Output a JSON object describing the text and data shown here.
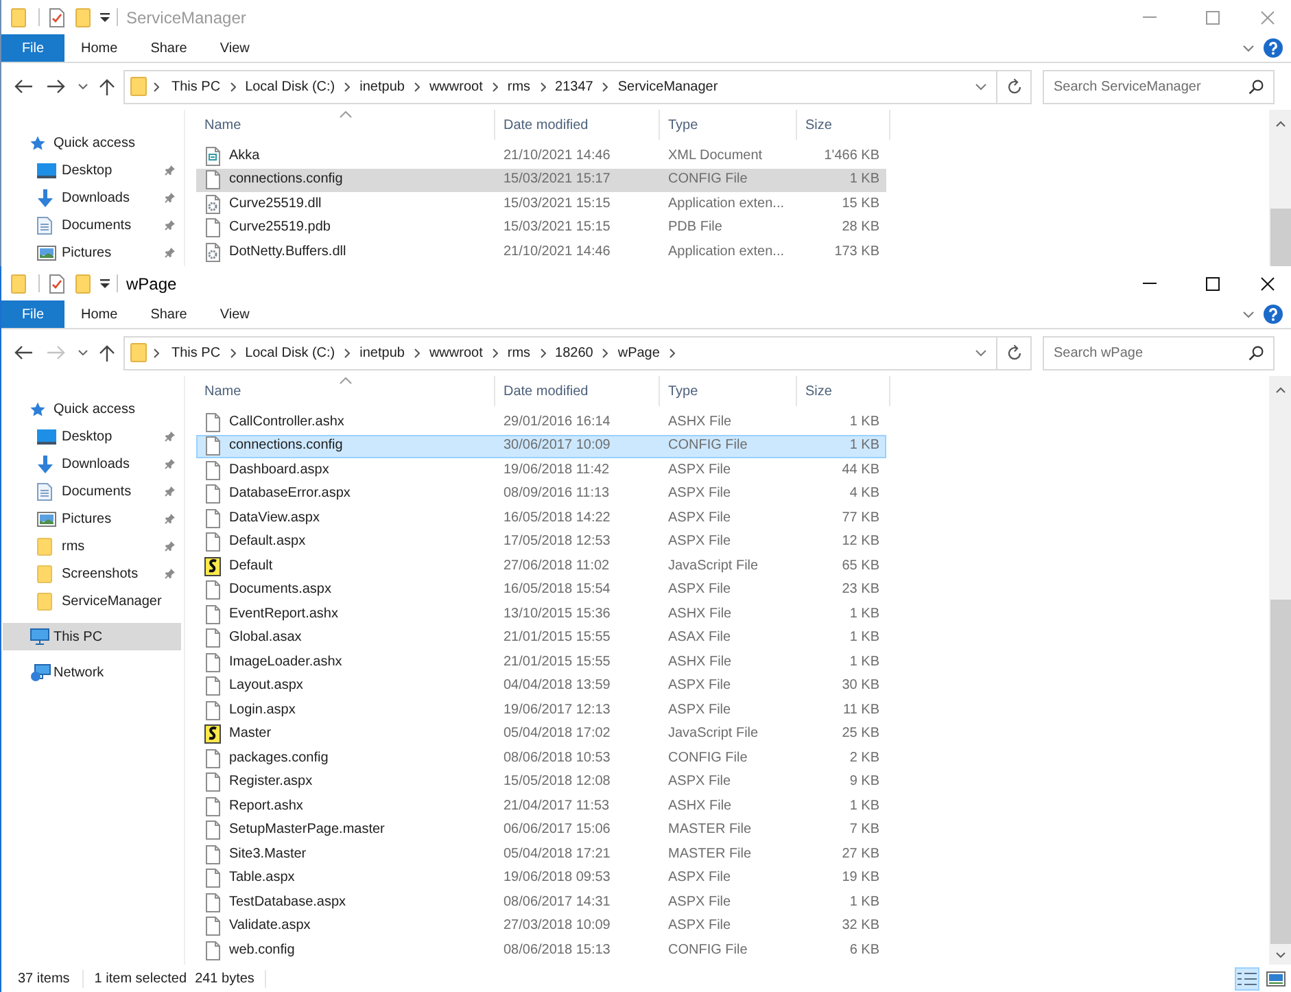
{
  "windows": [
    {
      "title": "ServiceManager",
      "active": false,
      "ribbon_tabs": [
        {
          "label": "File",
          "kind": "file"
        },
        {
          "label": "Home",
          "kind": "tab"
        },
        {
          "label": "Share",
          "kind": "tab"
        },
        {
          "label": "View",
          "kind": "tab"
        }
      ],
      "back_enabled": true,
      "forward_enabled": true,
      "address": {
        "crumbs": [
          "This PC",
          "Local Disk (C:)",
          "inetpub",
          "wwwroot",
          "rms",
          "21347",
          "ServiceManager"
        ],
        "trailing_chevron": false
      },
      "search": {
        "placeholder": "Search ServiceManager"
      },
      "columns": [
        {
          "label": "Name",
          "sorted": true
        },
        {
          "label": "Date modified",
          "sorted": false
        },
        {
          "label": "Type",
          "sorted": false
        },
        {
          "label": "Size",
          "sorted": false
        }
      ],
      "navigation": [
        {
          "label": "Quick access",
          "kind": "star",
          "selected": false,
          "children": [
            {
              "label": "Desktop",
              "kind": "desktop",
              "pinned": true,
              "selected": false
            },
            {
              "label": "Downloads",
              "kind": "downloads",
              "pinned": true,
              "selected": false
            },
            {
              "label": "Documents",
              "kind": "documents",
              "pinned": true,
              "selected": false
            },
            {
              "label": "Pictures",
              "kind": "pictures",
              "pinned": true,
              "selected": false
            }
          ]
        }
      ],
      "rows": [
        {
          "name": "Akka",
          "kind": "xml",
          "date_modified": "21/10/2021 14:46",
          "type": "XML Document",
          "size": "1'466 KB",
          "selected": false
        },
        {
          "name": "connections.config",
          "kind": "file",
          "date_modified": "15/03/2021 15:17",
          "type": "CONFIG File",
          "size": "1 KB",
          "selected": true
        },
        {
          "name": "Curve25519.dll",
          "kind": "dll",
          "date_modified": "15/03/2021 15:15",
          "type": "Application exten...",
          "size": "15 KB",
          "selected": false
        },
        {
          "name": "Curve25519.pdb",
          "kind": "file",
          "date_modified": "15/03/2021 15:15",
          "type": "PDB File",
          "size": "28 KB",
          "selected": false
        },
        {
          "name": "DotNetty.Buffers.dll",
          "kind": "dll",
          "date_modified": "21/10/2021 14:46",
          "type": "Application exten...",
          "size": "173 KB",
          "selected": false
        }
      ]
    },
    {
      "title": "wPage",
      "active": true,
      "ribbon_tabs": [
        {
          "label": "File",
          "kind": "file"
        },
        {
          "label": "Home",
          "kind": "tab"
        },
        {
          "label": "Share",
          "kind": "tab"
        },
        {
          "label": "View",
          "kind": "tab"
        }
      ],
      "back_enabled": true,
      "forward_enabled": false,
      "address": {
        "crumbs": [
          "This PC",
          "Local Disk (C:)",
          "inetpub",
          "wwwroot",
          "rms",
          "18260",
          "wPage"
        ],
        "trailing_chevron": true
      },
      "search": {
        "placeholder": "Search wPage"
      },
      "columns": [
        {
          "label": "Name",
          "sorted": true
        },
        {
          "label": "Date modified",
          "sorted": false
        },
        {
          "label": "Type",
          "sorted": false
        },
        {
          "label": "Size",
          "sorted": false
        }
      ],
      "navigation": [
        {
          "label": "Quick access",
          "kind": "star",
          "selected": false,
          "children": [
            {
              "label": "Desktop",
              "kind": "desktop",
              "pinned": true,
              "selected": false
            },
            {
              "label": "Downloads",
              "kind": "downloads",
              "pinned": true,
              "selected": false
            },
            {
              "label": "Documents",
              "kind": "documents",
              "pinned": true,
              "selected": false
            },
            {
              "label": "Pictures",
              "kind": "pictures",
              "pinned": true,
              "selected": false
            },
            {
              "label": "rms",
              "kind": "folder",
              "pinned": true,
              "selected": false
            },
            {
              "label": "Screenshots",
              "kind": "folder",
              "pinned": true,
              "selected": false
            },
            {
              "label": "ServiceManager",
              "kind": "folder",
              "pinned": false,
              "selected": false
            }
          ]
        },
        {
          "label": "This PC",
          "kind": "pc",
          "selected": true
        },
        {
          "label": "Network",
          "kind": "network",
          "selected": false
        }
      ],
      "rows": [
        {
          "name": "CallController.ashx",
          "kind": "file",
          "date_modified": "29/01/2016 16:14",
          "type": "ASHX File",
          "size": "1 KB",
          "selected": false
        },
        {
          "name": "connections.config",
          "kind": "file",
          "date_modified": "30/06/2017 10:09",
          "type": "CONFIG File",
          "size": "1 KB",
          "selected": true
        },
        {
          "name": "Dashboard.aspx",
          "kind": "file",
          "date_modified": "19/06/2018 11:42",
          "type": "ASPX File",
          "size": "44 KB",
          "selected": false
        },
        {
          "name": "DatabaseError.aspx",
          "kind": "file",
          "date_modified": "08/09/2016 11:13",
          "type": "ASPX File",
          "size": "4 KB",
          "selected": false
        },
        {
          "name": "DataView.aspx",
          "kind": "file",
          "date_modified": "16/05/2018 14:22",
          "type": "ASPX File",
          "size": "77 KB",
          "selected": false
        },
        {
          "name": "Default.aspx",
          "kind": "file",
          "date_modified": "17/05/2018 12:53",
          "type": "ASPX File",
          "size": "12 KB",
          "selected": false
        },
        {
          "name": "Default",
          "kind": "script",
          "date_modified": "27/06/2018 11:02",
          "type": "JavaScript File",
          "size": "65 KB",
          "selected": false
        },
        {
          "name": "Documents.aspx",
          "kind": "file",
          "date_modified": "16/05/2018 15:54",
          "type": "ASPX File",
          "size": "23 KB",
          "selected": false
        },
        {
          "name": "EventReport.ashx",
          "kind": "file",
          "date_modified": "13/10/2015 15:36",
          "type": "ASHX File",
          "size": "1 KB",
          "selected": false
        },
        {
          "name": "Global.asax",
          "kind": "file",
          "date_modified": "21/01/2015 15:55",
          "type": "ASAX File",
          "size": "1 KB",
          "selected": false
        },
        {
          "name": "ImageLoader.ashx",
          "kind": "file",
          "date_modified": "21/01/2015 15:55",
          "type": "ASHX File",
          "size": "1 KB",
          "selected": false
        },
        {
          "name": "Layout.aspx",
          "kind": "file",
          "date_modified": "04/04/2018 13:59",
          "type": "ASPX File",
          "size": "30 KB",
          "selected": false
        },
        {
          "name": "Login.aspx",
          "kind": "file",
          "date_modified": "19/06/2017 12:13",
          "type": "ASPX File",
          "size": "11 KB",
          "selected": false
        },
        {
          "name": "Master",
          "kind": "script",
          "date_modified": "05/04/2018 17:02",
          "type": "JavaScript File",
          "size": "25 KB",
          "selected": false
        },
        {
          "name": "packages.config",
          "kind": "file",
          "date_modified": "08/06/2018 10:53",
          "type": "CONFIG File",
          "size": "2 KB",
          "selected": false
        },
        {
          "name": "Register.aspx",
          "kind": "file",
          "date_modified": "15/05/2018 12:08",
          "type": "ASPX File",
          "size": "9 KB",
          "selected": false
        },
        {
          "name": "Report.ashx",
          "kind": "file",
          "date_modified": "21/04/2017 11:53",
          "type": "ASHX File",
          "size": "1 KB",
          "selected": false
        },
        {
          "name": "SetupMasterPage.master",
          "kind": "file",
          "date_modified": "06/06/2017 15:06",
          "type": "MASTER File",
          "size": "7 KB",
          "selected": false
        },
        {
          "name": "Site3.Master",
          "kind": "file",
          "date_modified": "05/04/2018 17:21",
          "type": "MASTER File",
          "size": "27 KB",
          "selected": false
        },
        {
          "name": "Table.aspx",
          "kind": "file",
          "date_modified": "19/06/2018 09:53",
          "type": "ASPX File",
          "size": "19 KB",
          "selected": false
        },
        {
          "name": "TestDatabase.aspx",
          "kind": "file",
          "date_modified": "08/06/2017 14:31",
          "type": "ASPX File",
          "size": "1 KB",
          "selected": false
        },
        {
          "name": "Validate.aspx",
          "kind": "file",
          "date_modified": "27/03/2018 10:09",
          "type": "ASPX File",
          "size": "32 KB",
          "selected": false
        },
        {
          "name": "web.config",
          "kind": "file",
          "date_modified": "08/06/2018 15:13",
          "type": "CONFIG File",
          "size": "6 KB",
          "selected": false
        }
      ],
      "status_bar": {
        "item_count": "37 items",
        "selection": "1 item selected",
        "selection_size": "241 bytes",
        "view_buttons": [
          {
            "kind": "details",
            "selected": true
          },
          {
            "kind": "large_icons",
            "selected": false
          }
        ]
      }
    }
  ]
}
